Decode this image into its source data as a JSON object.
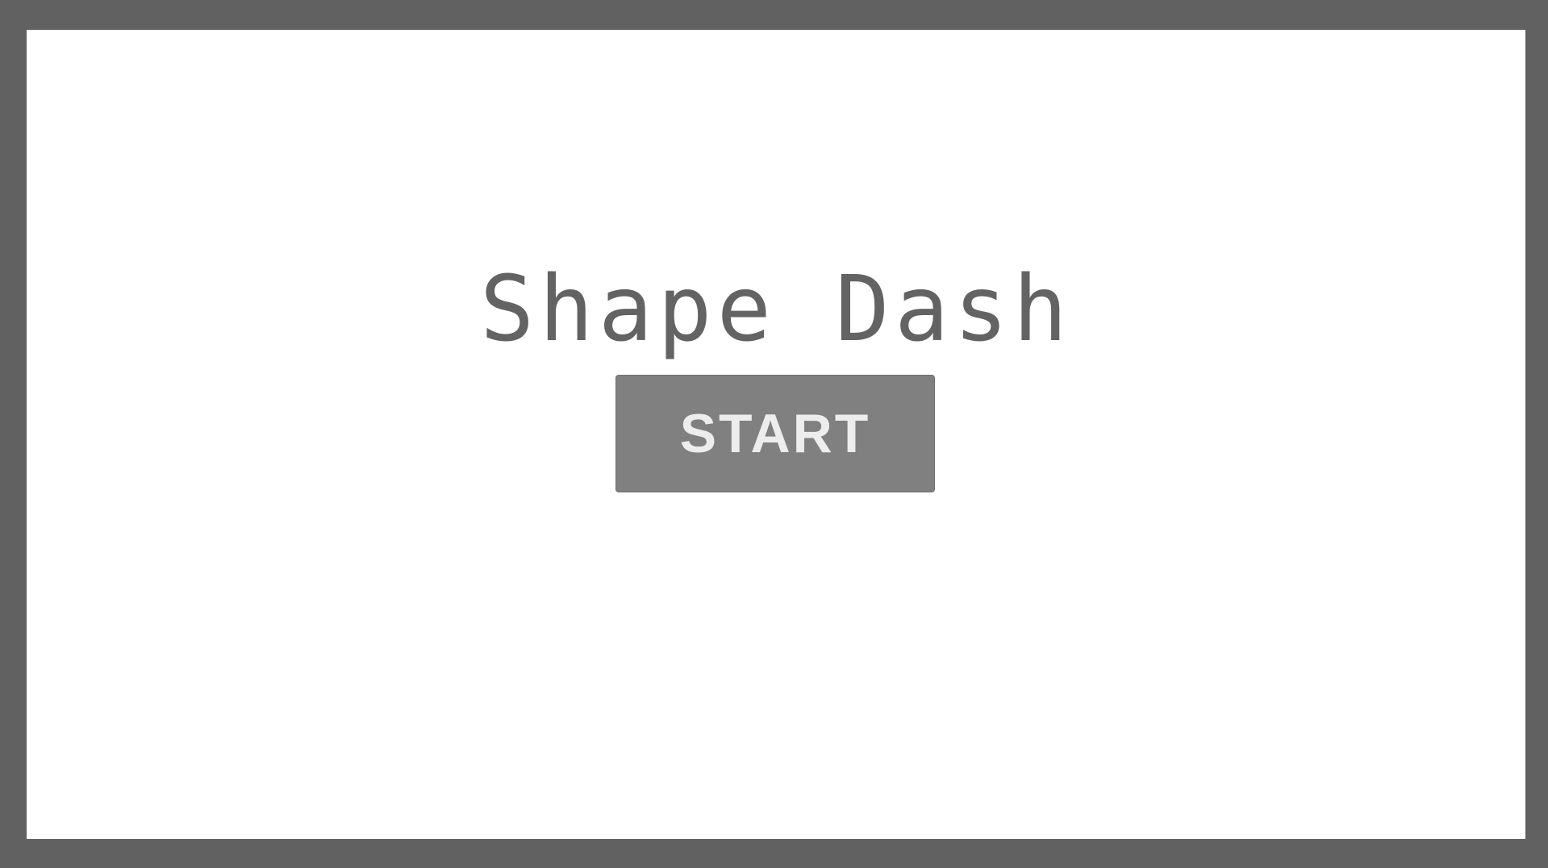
{
  "game": {
    "title": "Shape Dash",
    "start_label": "START"
  },
  "colors": {
    "outer_background": "#616161",
    "canvas_background": "#ffffff",
    "title_color": "#636363",
    "button_background": "#808080",
    "button_text": "#ededed"
  }
}
